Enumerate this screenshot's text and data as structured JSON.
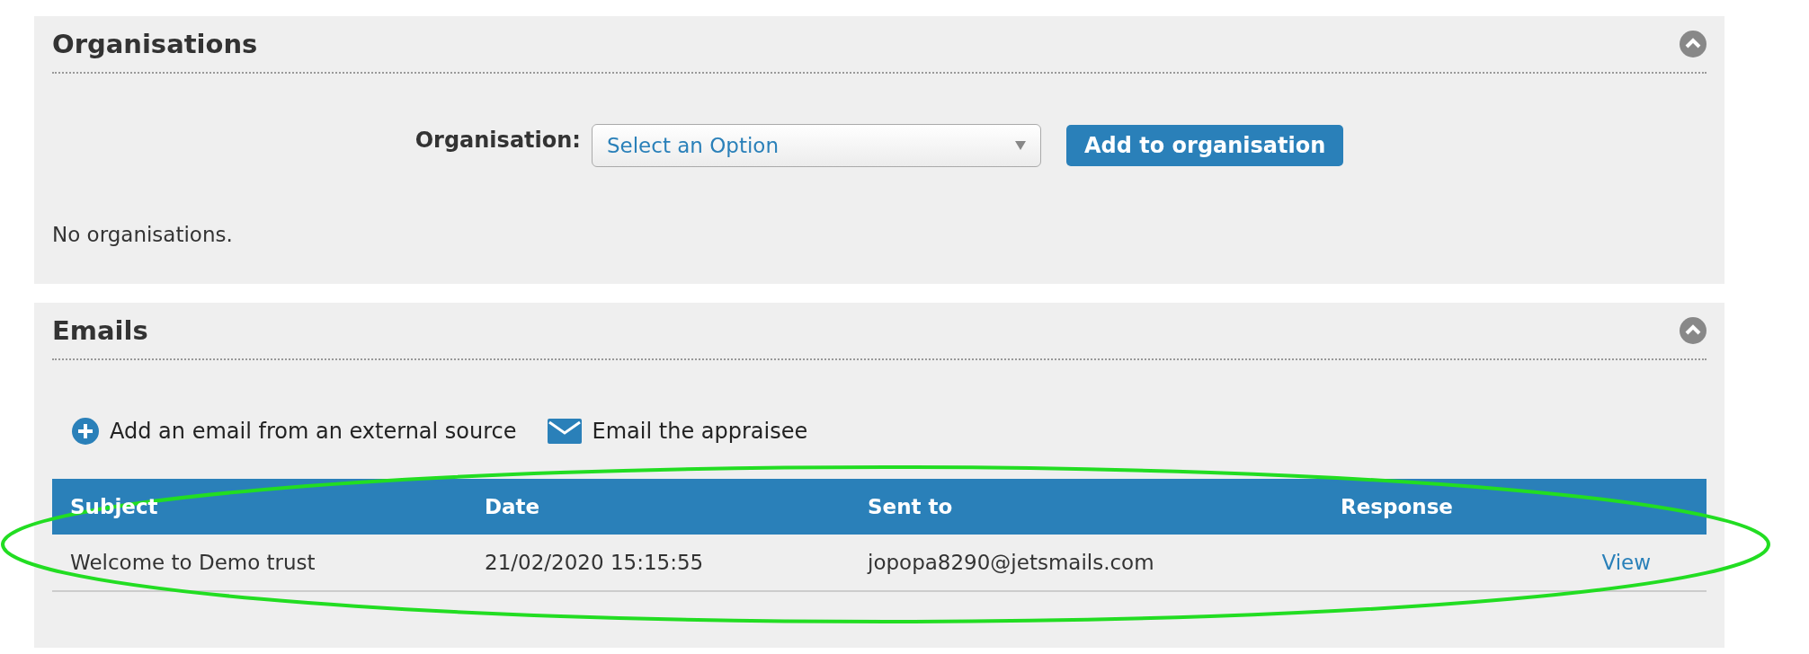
{
  "organisations_panel": {
    "title": "Organisations",
    "expanded": true,
    "field_label": "Organisation:",
    "select": {
      "placeholder": "Select an Option"
    },
    "button": "Add to organisation",
    "empty_message": "No organisations."
  },
  "emails_panel": {
    "title": "Emails",
    "expanded": true,
    "actions": [
      {
        "kind": "add",
        "label": "Add an email from an external source"
      },
      {
        "kind": "email",
        "label": "Email the appraisee"
      }
    ],
    "table": {
      "columns": [
        "Subject",
        "Date",
        "Sent to",
        "Response"
      ],
      "rows": [
        {
          "subject": "Welcome to Demo trust",
          "date": "21/02/2020 15:15:55",
          "sent_to": "jopopa8290@jetsmails.com",
          "response": "View"
        }
      ]
    }
  },
  "annotation": {
    "kind": "ellipse",
    "color": "#22dd22"
  }
}
